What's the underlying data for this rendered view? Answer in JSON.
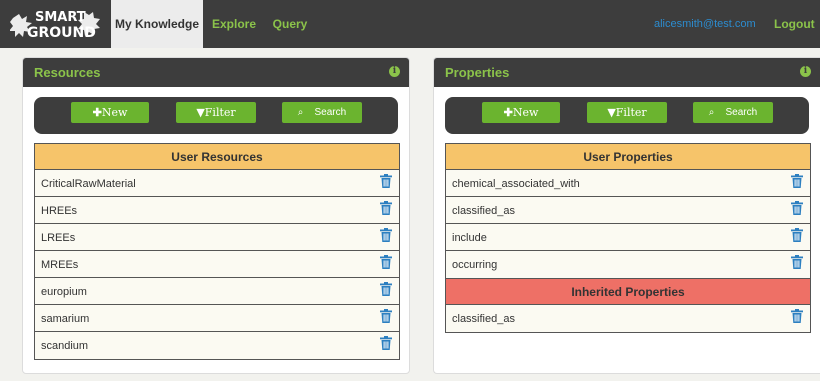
{
  "nav": {
    "logo_text": [
      "SMART",
      "GROUND"
    ],
    "tabs": [
      {
        "label": "My Knowledge",
        "active": true
      },
      {
        "label": "Explore",
        "active": false
      },
      {
        "label": "Query",
        "active": false
      }
    ],
    "user": "alicesmith@test.com",
    "logout": "Logout"
  },
  "resources": {
    "title": "Resources",
    "info_icon": "info-icon",
    "toolbar": {
      "new": "New",
      "filter": "Filter",
      "search": "Search"
    },
    "section_title": "User Resources",
    "items": [
      "CriticalRawMaterial",
      "HREEs",
      "LREEs",
      "MREEs",
      "europium",
      "samarium",
      "scandium"
    ]
  },
  "properties": {
    "title": "Properties",
    "info_icon": "info-icon",
    "toolbar": {
      "new": "New",
      "filter": "Filter",
      "search": "Search"
    },
    "section_title": "User Properties",
    "items": [
      "chemical_associated_with",
      "classified_as",
      "include",
      "occurring"
    ],
    "inherited_title": "Inherited Properties",
    "inherited_items": [
      "classified_as"
    ]
  },
  "colors": {
    "accent": "#8bc34a",
    "button": "#6bb42f",
    "header_bar": "#3d3d3d",
    "user_section": "#f6c46a",
    "inherited_section": "#ee7066",
    "trash": "#2c7fc0"
  }
}
